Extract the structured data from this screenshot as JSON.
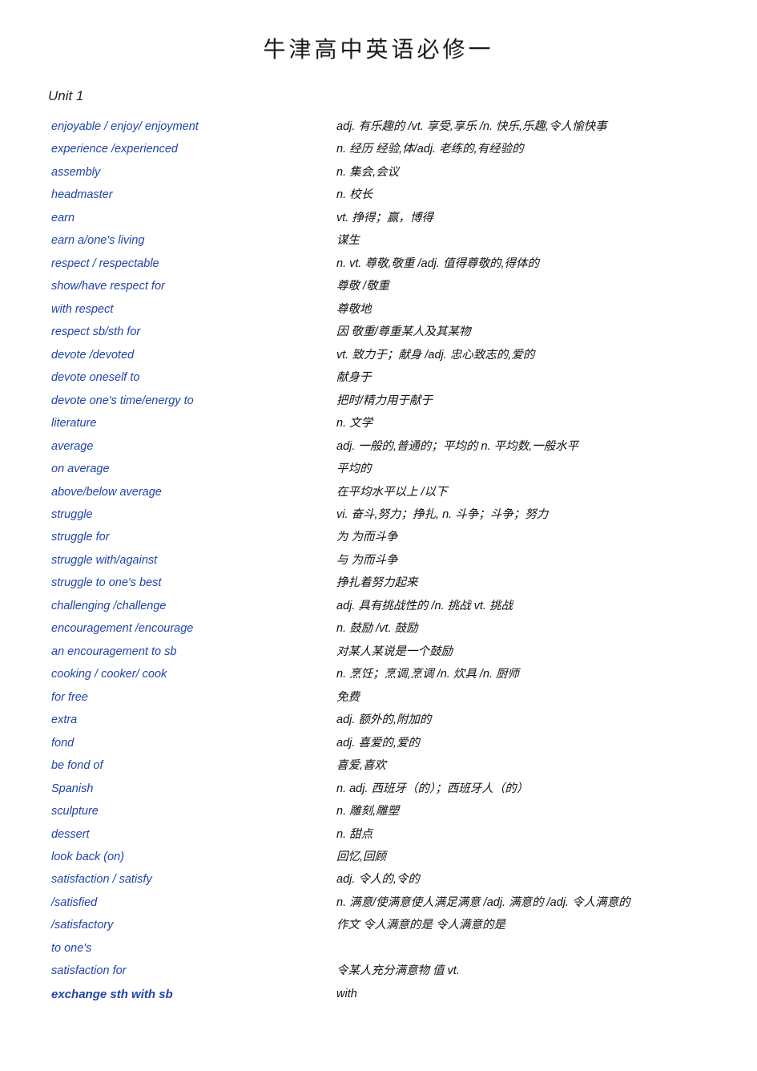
{
  "page": {
    "title": "牛津高中英语必修一",
    "unit": "Unit 1"
  },
  "entries": [
    {
      "word": "enjoyable / enjoy/ enjoyment",
      "definition": "adj. 有乐趣的 /vt. 享受,享乐 /n. 快乐,乐趣,令人愉快事"
    },
    {
      "word": "experience /experienced",
      "definition": "n. 经历 经验,体/adj. 老练的,有经验的"
    },
    {
      "word": "assembly",
      "definition": "n. 集会,会议"
    },
    {
      "word": "headmaster",
      "definition": "n. 校长"
    },
    {
      "word": "earn",
      "definition": "vt.  挣得；赢，博得"
    },
    {
      "word": "earn  a/one's living",
      "definition": "谋生"
    },
    {
      "word": "respect  / respectable",
      "definition": "n. vt. 尊敬,敬重 /adj. 值得尊敬的,得体的"
    },
    {
      "word": "show/have respect for",
      "definition": "尊敬 /敬重"
    },
    {
      "word": "with respect",
      "definition": "尊敬地"
    },
    {
      "word": "respect sb/sth for",
      "definition": "因   敬重/尊重某人及其某物"
    },
    {
      "word": "devote /devoted",
      "definition": "vt. 致力于；献身  /adj. 忠心致志的,爱的"
    },
    {
      "word": "devote  oneself to",
      "definition": "献身于"
    },
    {
      "word": "devote  one's time/energy to",
      "definition": "把时/精力用于献于"
    },
    {
      "word": "literature",
      "definition": "n. 文学"
    },
    {
      "word": "average",
      "definition": "adj. 一般的,普通的；平均的     n. 平均数,一般水平"
    },
    {
      "word": "on average",
      "definition": "平均的"
    },
    {
      "word": "above/below average",
      "definition": "在平均水平以上  /以下"
    },
    {
      "word": "struggle",
      "definition": "vi. 奋斗,努力；挣扎,  n.  斗争；斗争；努力"
    },
    {
      "word": "struggle  for",
      "definition": "为   为而斗争"
    },
    {
      "word": "struggle  with/against",
      "definition": "与    为而斗争"
    },
    {
      "word": "struggle   to one's best",
      "definition": "挣扎着努力起来"
    },
    {
      "word": "challenging /challenge",
      "definition": "adj. 具有挑战性的 /n. 挑战 vt.  挑战"
    },
    {
      "word": "encouragement /encourage",
      "definition": "n. 鼓励 /vt. 鼓励"
    },
    {
      "word": "an encouragement  to sb",
      "definition": "对某人某说是一个鼓励"
    },
    {
      "word": "cooking / cooker/ cook",
      "definition": "n. 烹饪；烹调,烹调  /n. 炊具 /n. 厨师"
    },
    {
      "word": "for free",
      "definition": "免费"
    },
    {
      "word": "extra",
      "definition": "adj. 额外的,附加的"
    },
    {
      "word": "fond",
      "definition": "adj.  喜爱的,爱的"
    },
    {
      "word": "be fond of",
      "definition": "喜爱,喜欢"
    },
    {
      "word": "Spanish",
      "definition": "n.  adj. 西班牙（的）；西班牙人（的）"
    },
    {
      "word": "sculpture",
      "definition": "n. 雕刻,雕塑"
    },
    {
      "word": "dessert",
      "definition": "n.  甜点"
    },
    {
      "word": "look back (on)",
      "definition": "回忆,回顾"
    },
    {
      "word": "satisfaction / satisfy",
      "definition": "adj.  令人的,令的"
    },
    {
      "word": "/satisfied",
      "definition": "n. 满意/使满意使人满足满意 /adj. 满意的  /adj. 令人满意的"
    },
    {
      "word": "/satisfactory",
      "definition": "作文\n令人满意的是\n令人满意的是"
    },
    {
      "word": "to one's",
      "definition": ""
    },
    {
      "word": "satisfaction for",
      "definition": "令某人充分满意物\n值 vt."
    },
    {
      "word": "exchange  sth with sb",
      "definition": "with"
    }
  ]
}
